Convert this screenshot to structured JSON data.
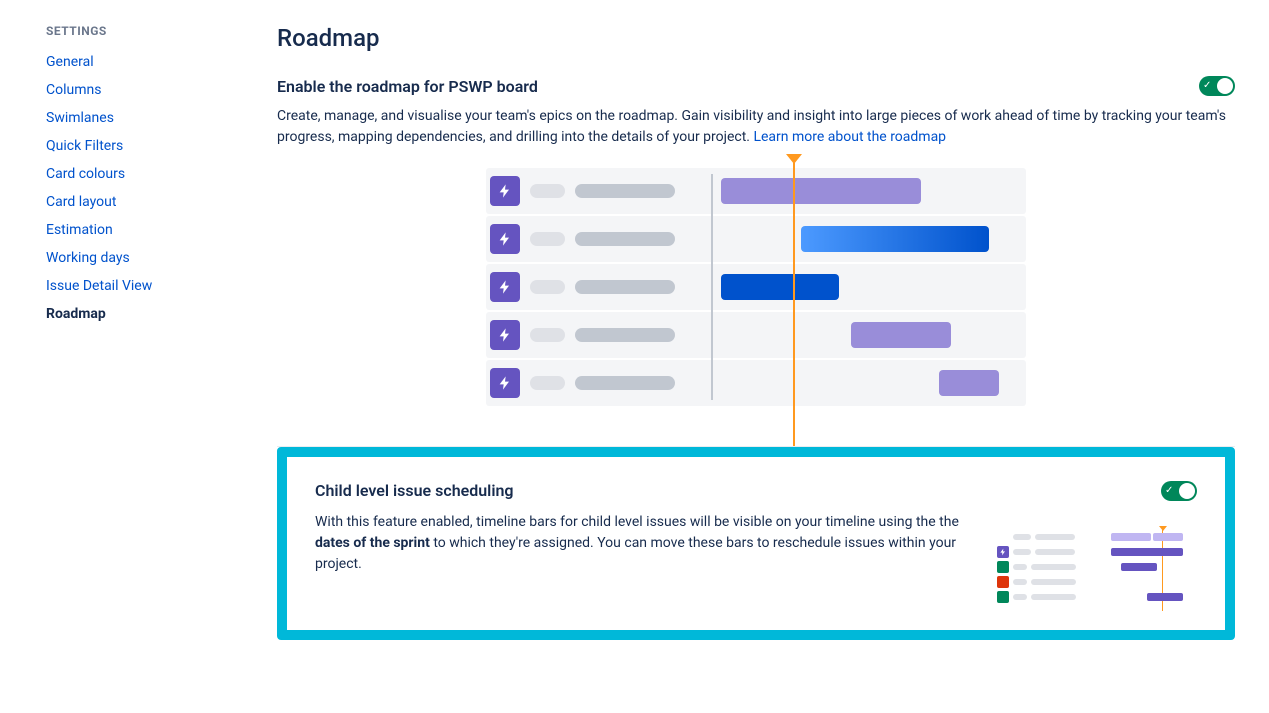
{
  "sidebar": {
    "heading": "SETTINGS",
    "items": [
      {
        "label": "General",
        "active": false
      },
      {
        "label": "Columns",
        "active": false
      },
      {
        "label": "Swimlanes",
        "active": false
      },
      {
        "label": "Quick Filters",
        "active": false
      },
      {
        "label": "Card colours",
        "active": false
      },
      {
        "label": "Card layout",
        "active": false
      },
      {
        "label": "Estimation",
        "active": false
      },
      {
        "label": "Working days",
        "active": false
      },
      {
        "label": "Issue Detail View",
        "active": false
      },
      {
        "label": "Roadmap",
        "active": true
      }
    ]
  },
  "page": {
    "title": "Roadmap"
  },
  "roadmap": {
    "heading": "Enable the roadmap for PSWP board",
    "toggle_on": true,
    "description": "Create, manage, and visualise your team's epics on the roadmap. Gain visibility and insight into large pieces of work ahead of time by tracking your team's progress, mapping dependencies, and drilling into the details of your project. ",
    "learn_more": "Learn more about the roadmap"
  },
  "child": {
    "heading": "Child level issue scheduling",
    "toggle_on": true,
    "desc_a": "With this feature enabled, timeline bars for child level issues will be visible on your timeline using the the ",
    "desc_b": "dates of the sprint",
    "desc_c": " to which they're assigned. You can move these bars to reschedule issues within your project."
  }
}
